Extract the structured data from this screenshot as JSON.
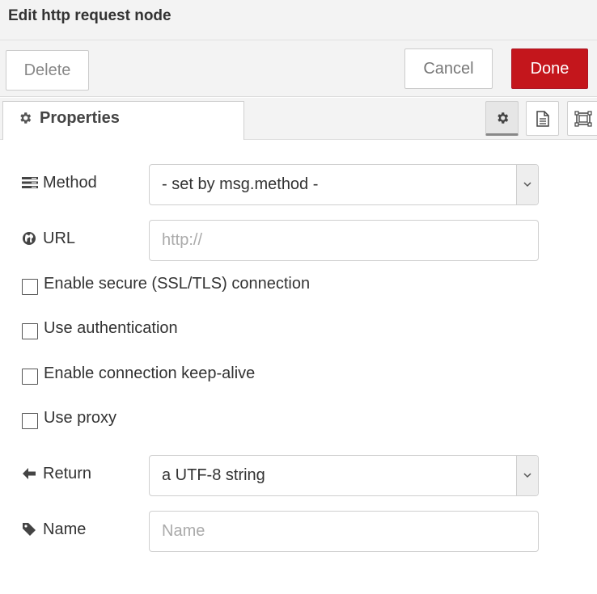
{
  "header": {
    "title": "Edit http request node"
  },
  "toolbar": {
    "delete_label": "Delete",
    "cancel_label": "Cancel",
    "done_label": "Done"
  },
  "tabs": {
    "properties_label": "Properties",
    "side_icons": [
      "gear-icon",
      "description-icon",
      "appearance-icon"
    ]
  },
  "form": {
    "method": {
      "label": "Method",
      "value": "- set by msg.method -"
    },
    "url": {
      "label": "URL",
      "placeholder": "http://",
      "value": ""
    },
    "checkboxes": [
      {
        "label": "Enable secure (SSL/TLS) connection",
        "checked": false
      },
      {
        "label": "Use authentication",
        "checked": false
      },
      {
        "label": "Enable connection keep-alive",
        "checked": false
      },
      {
        "label": "Use proxy",
        "checked": false
      }
    ],
    "return": {
      "label": "Return",
      "value": "a UTF-8 string"
    },
    "name": {
      "label": "Name",
      "placeholder": "Name",
      "value": ""
    }
  },
  "colors": {
    "done_button": "#c4161c",
    "toolbar_bg": "#f3f3f3"
  }
}
